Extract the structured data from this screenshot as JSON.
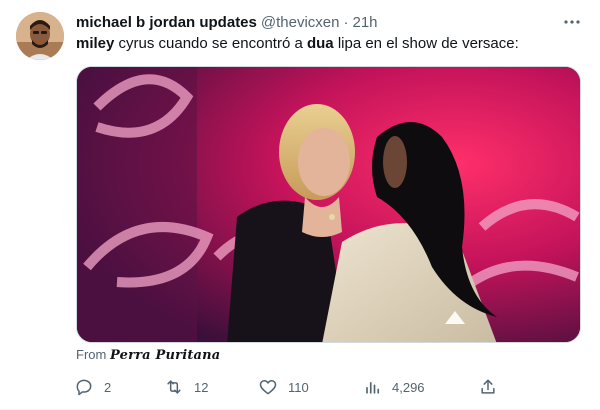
{
  "tweet": {
    "display_name": "michael b jordan updates",
    "handle": "@thevicxen",
    "separator": "·",
    "time": "21h",
    "text_parts": [
      "miley",
      " cyrus cuando se encontró a ",
      "dua",
      " lipa en el show de versace:"
    ],
    "source_prefix": "From",
    "source_name": "Perra Puritana"
  },
  "actions": {
    "reply_count": "2",
    "retweet_count": "12",
    "like_count": "110",
    "views_count": "4,296"
  },
  "icons": {
    "more": "more-horizontal-icon",
    "reply": "reply-icon",
    "retweet": "retweet-icon",
    "like": "heart-icon",
    "views": "views-bar-chart-icon",
    "share": "share-icon"
  },
  "colors": {
    "text_primary": "#0f1419",
    "text_secondary": "#536471",
    "border": "#cfd9de"
  }
}
